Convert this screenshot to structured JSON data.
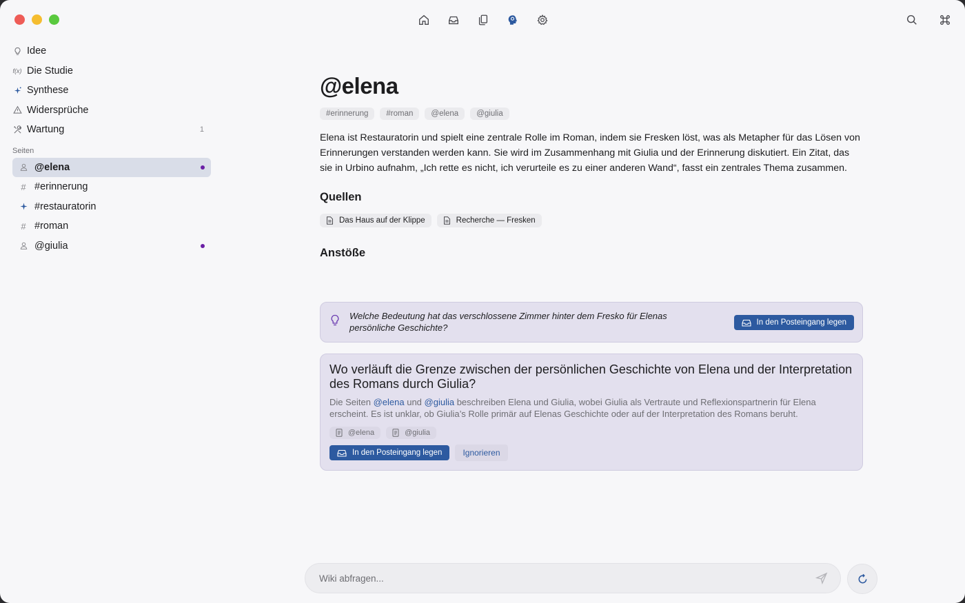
{
  "colors": {
    "accent": "#2d5aa0",
    "unread_dot": "#6a1fa5",
    "card_bg": "#e3e0ee"
  },
  "toolbar": {
    "center_icons": [
      "home-icon",
      "inbox-icon",
      "documents-icon",
      "brain-icon",
      "gear-icon"
    ],
    "right_icons": [
      "search-icon",
      "command-icon"
    ]
  },
  "sidebar": {
    "nav": [
      {
        "label": "Idee",
        "icon": "lightbulb-icon"
      },
      {
        "label": "Die Studie",
        "icon": "function-icon"
      },
      {
        "label": "Synthese",
        "icon": "sparkle-icon"
      },
      {
        "label": "Widersprüche",
        "icon": "warning-icon"
      },
      {
        "label": "Wartung",
        "icon": "tools-icon",
        "count": "1"
      }
    ],
    "pages_heading": "Seiten",
    "pages": [
      {
        "label": "@elena",
        "icon": "person-icon",
        "active": true,
        "dot": true
      },
      {
        "label": "#erinnerung",
        "icon": "hash-icon"
      },
      {
        "label": "#restauratorin",
        "icon": "sparkle-icon"
      },
      {
        "label": "#roman",
        "icon": "hash-icon"
      },
      {
        "label": "@giulia",
        "icon": "person-icon",
        "dot": true
      }
    ]
  },
  "main": {
    "title": "@elena",
    "tags": [
      "#erinnerung",
      "#roman",
      "@elena",
      "@giulia"
    ],
    "description": "Elena ist Restauratorin und spielt eine zentrale Rolle im Roman, indem sie Fresken löst, was als Metapher für das Lösen von Erinnerungen verstanden werden kann. Sie wird im Zusammenhang mit Giulia und der Erinnerung diskutiert. Ein Zitat, das sie in Urbino aufnahm, „Ich rette es nicht, ich verurteile es zu einer anderen Wand“, fasst ein zentrales Thema zusammen.",
    "sources_title": "Quellen",
    "sources": [
      "Das Haus auf der Klippe",
      "Recherche — Fresken"
    ],
    "prompts_title": "Anstöße",
    "prompt1": {
      "question": "Welche Bedeutung hat das verschlossene Zimmer hinter dem Fresko für Elenas persönliche Geschichte?",
      "action": "In den Posteingang legen"
    },
    "prompt2": {
      "question": "Wo verläuft die Grenze zwischen der persönlichen Geschichte von Elena und der Interpretation des Romans durch Giulia?",
      "body_prefix": "Die Seiten ",
      "link1": "@elena",
      "body_mid": " und ",
      "link2": "@giulia",
      "body_suffix": " beschreiben Elena und Giulia, wobei Giulia als Vertraute und Reflexionspartnerin für Elena erscheint. Es ist unklar, ob Giulia’s Rolle primär auf Elenas Geschichte oder auf der Interpretation des Romans beruht.",
      "refs": [
        "@elena",
        "@giulia"
      ],
      "action": "In den Posteingang legen",
      "dismiss": "Ignorieren"
    }
  },
  "query": {
    "placeholder": "Wiki abfragen..."
  }
}
